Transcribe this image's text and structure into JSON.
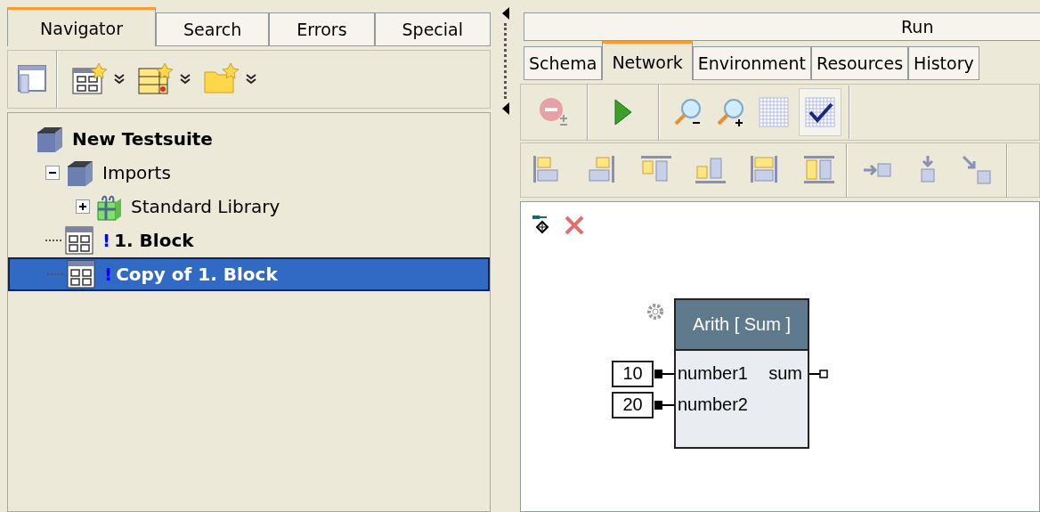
{
  "navigator": {
    "tabs": [
      {
        "label": "Navigator",
        "selected": true
      },
      {
        "label": "Search",
        "selected": false
      },
      {
        "label": "Errors",
        "selected": false
      },
      {
        "label": "Special",
        "selected": false
      }
    ],
    "tree": [
      {
        "label": "New Testsuite",
        "kind": "suite",
        "bold": true,
        "selected": false,
        "children": [
          {
            "label": "Imports",
            "kind": "package",
            "bold": false,
            "selected": false,
            "expanded": true,
            "children": [
              {
                "label": "Standard Library",
                "kind": "library",
                "bold": false,
                "selected": false,
                "expanded": false
              }
            ]
          },
          {
            "label": "1. Block",
            "kind": "block",
            "marker": "!",
            "bold": true,
            "selected": false
          },
          {
            "label": "Copy of 1. Block",
            "kind": "block",
            "marker": "!",
            "bold": true,
            "selected": true
          }
        ]
      }
    ]
  },
  "run": {
    "title": "Run",
    "tabs": [
      {
        "label": "Schema",
        "selected": false
      },
      {
        "label": "Network",
        "selected": true
      },
      {
        "label": "Environment",
        "selected": false
      },
      {
        "label": "Resources",
        "selected": false
      },
      {
        "label": "History",
        "selected": false
      }
    ],
    "grid_check": {
      "selected": true
    },
    "node": {
      "title": "Arith [ Sum ]",
      "inputs": [
        {
          "name": "number1",
          "value": "10"
        },
        {
          "name": "number2",
          "value": "20"
        }
      ],
      "outputs": [
        {
          "name": "sum"
        }
      ]
    }
  }
}
